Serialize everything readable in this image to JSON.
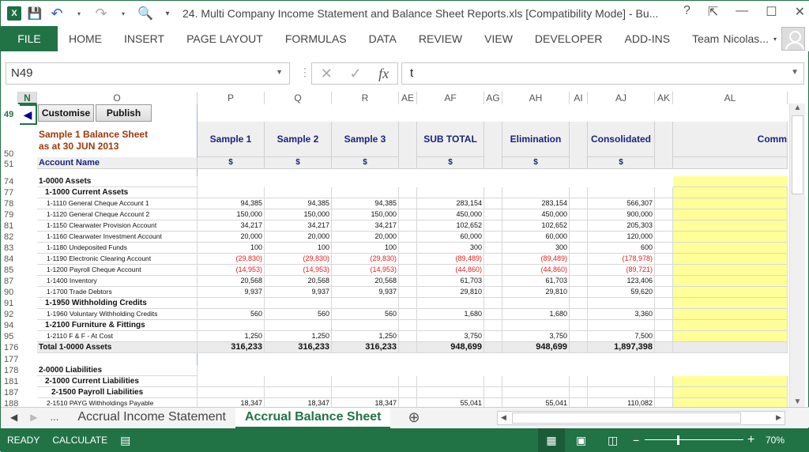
{
  "window": {
    "title": "24. Multi Company Income Statement and Balance Sheet Reports.xls  [Compatibility Mode] - Bu...",
    "help": "?"
  },
  "ribbon": {
    "tabs": [
      "FILE",
      "HOME",
      "INSERT",
      "PAGE LAYOUT",
      "FORMULAS",
      "DATA",
      "REVIEW",
      "VIEW",
      "DEVELOPER",
      "ADD-INS",
      "Team"
    ],
    "user": "Nicolas..."
  },
  "formula_bar": {
    "name_box": "N49",
    "content": "t"
  },
  "columns": [
    "N",
    "O",
    "P",
    "Q",
    "R",
    "AE",
    "AF",
    "AG",
    "AH",
    "AI",
    "AJ",
    "AK",
    "AL"
  ],
  "buttons": {
    "back": "◀",
    "customise": "Customise",
    "publish": "Publish"
  },
  "report": {
    "title_line1": "Sample 1 Balance Sheet",
    "title_line2": "as at 30 JUN 2013",
    "account_header": "Account Name",
    "col_headers": [
      "Sample 1",
      "Sample 2",
      "Sample 3",
      "SUB TOTAL",
      "Elimination",
      "Consolidated",
      "Comm"
    ],
    "currency": "$"
  },
  "rows": [
    {
      "r": "49"
    },
    {
      "r": "50"
    },
    {
      "r": "51"
    },
    {
      "r": "74",
      "name": "1-0000 Assets",
      "type": "h1"
    },
    {
      "r": "77",
      "name": "1-1000 Current Assets",
      "type": "h2"
    },
    {
      "r": "78",
      "name": "1-1110 General Cheque Account 1",
      "v": [
        "94,385",
        "94,385",
        "94,385",
        "283,154",
        "283,154",
        "566,307"
      ]
    },
    {
      "r": "79",
      "name": "1-1120 General Cheque Account 2",
      "v": [
        "150,000",
        "150,000",
        "150,000",
        "450,000",
        "450,000",
        "900,000"
      ]
    },
    {
      "r": "81",
      "name": "1-1150 Clearwater Provision Account",
      "v": [
        "34,217",
        "34,217",
        "34,217",
        "102,652",
        "102,652",
        "205,303"
      ]
    },
    {
      "r": "82",
      "name": "1-1160 Clearwater Investment Account",
      "v": [
        "20,000",
        "20,000",
        "20,000",
        "60,000",
        "60,000",
        "120,000"
      ]
    },
    {
      "r": "83",
      "name": "1-1180 Undeposited Funds",
      "v": [
        "100",
        "100",
        "100",
        "300",
        "300",
        "600"
      ]
    },
    {
      "r": "84",
      "name": "1-1190 Electronic Clearing Account",
      "v": [
        "(29,830)",
        "(29,830)",
        "(29,830)",
        "(89,489)",
        "(89,489)",
        "(178,978)"
      ],
      "neg": true
    },
    {
      "r": "85",
      "name": "1-1200 Payroll Cheque Account",
      "v": [
        "(14,953)",
        "(14,953)",
        "(14,953)",
        "(44,860)",
        "(44,860)",
        "(89,721)"
      ],
      "neg": true
    },
    {
      "r": "87",
      "name": "1-1400 Inventory",
      "v": [
        "20,568",
        "20,568",
        "20,568",
        "61,703",
        "61,703",
        "123,406"
      ]
    },
    {
      "r": "90",
      "name": "1-1700 Trade Debtors",
      "v": [
        "9,937",
        "9,937",
        "9,937",
        "29,810",
        "29,810",
        "59,620"
      ]
    },
    {
      "r": "91",
      "name": "1-1950 Withholding Credits",
      "type": "h2"
    },
    {
      "r": "92",
      "name": "1-1960 Voluntary Withholding Credits",
      "v": [
        "560",
        "560",
        "560",
        "1,680",
        "1,680",
        "3,360"
      ]
    },
    {
      "r": "94",
      "name": "1-2100 Furniture & Fittings",
      "type": "h2"
    },
    {
      "r": "95",
      "name": "1-2110 F & F  - At Cost",
      "v": [
        "1,250",
        "1,250",
        "1,250",
        "3,750",
        "3,750",
        "7,500"
      ]
    },
    {
      "r": "176",
      "name": "Total 1-0000 Assets",
      "type": "total",
      "v": [
        "316,233",
        "316,233",
        "316,233",
        "948,699",
        "948,699",
        "1,897,398"
      ]
    },
    {
      "r": "177",
      "type": "blank"
    },
    {
      "r": "178",
      "name": "2-0000 Liabilities",
      "type": "h1"
    },
    {
      "r": "181",
      "name": "2-1000 Current Liabilities",
      "type": "h2"
    },
    {
      "r": "187",
      "name": "2-1500 Payroll Liabilities",
      "type": "h3"
    },
    {
      "r": "188",
      "name": "2-1510 PAYG Withholdings Payable",
      "v": [
        "18,347",
        "18,347",
        "18,347",
        "55,041",
        "55,041",
        "110,082"
      ]
    }
  ],
  "sheet_tabs": {
    "nav_more": "...",
    "tabs": [
      "Accrual Income Statement",
      "Accrual Balance Sheet"
    ],
    "active": 1
  },
  "status": {
    "ready": "READY",
    "calculate": "CALCULATE",
    "zoom": "70%"
  }
}
